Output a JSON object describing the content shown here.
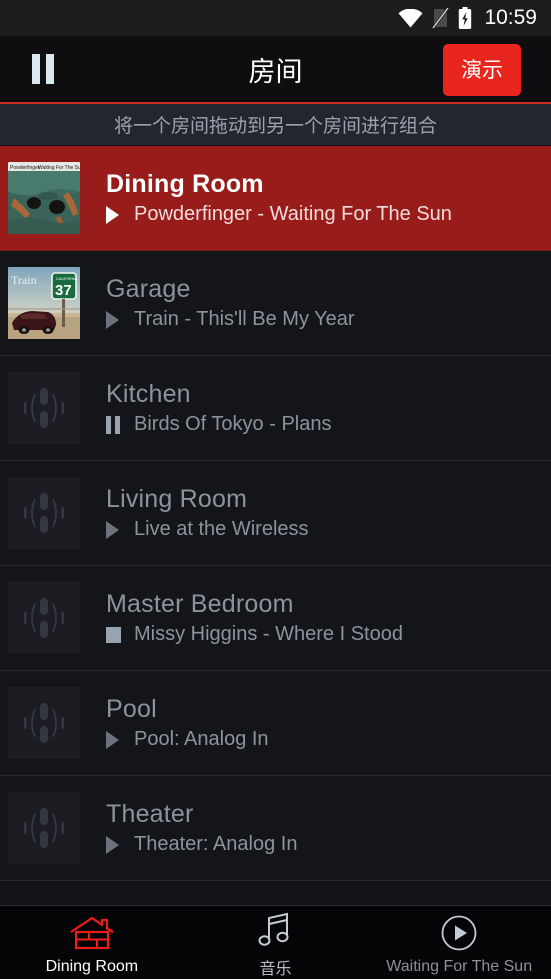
{
  "statusbar": {
    "time": "10:59",
    "icons": [
      "wifi-icon",
      "no-sim-icon",
      "battery-charging-icon"
    ]
  },
  "appbar": {
    "pause_label": "pause-button",
    "title": "房间",
    "demo_label": "演示",
    "accent_color": "#e8261e"
  },
  "hint": {
    "text": "将一个房间拖动到另一个房间进行组合"
  },
  "rooms": [
    {
      "name": "Dining Room",
      "track": "Powderfinger - Waiting For The Sun",
      "state": "play",
      "art": "album-art-waiting-for-the-sun",
      "selected": true
    },
    {
      "name": "Garage",
      "track": "Train - This'll Be My Year",
      "state": "play",
      "art": "album-art-train-california-37",
      "selected": false
    },
    {
      "name": "Kitchen",
      "track": "Birds Of Tokyo - Plans",
      "state": "pause",
      "art": "speaker-placeholder",
      "selected": false
    },
    {
      "name": "Living Room",
      "track": "Live at the Wireless",
      "state": "play",
      "art": "speaker-placeholder",
      "selected": false
    },
    {
      "name": "Master Bedroom",
      "track": "Missy Higgins - Where I Stood",
      "state": "stop",
      "art": "speaker-placeholder",
      "selected": false
    },
    {
      "name": "Pool",
      "track": "Pool: Analog In",
      "state": "play",
      "art": "speaker-placeholder",
      "selected": false
    },
    {
      "name": "Theater",
      "track": "Theater: Analog In",
      "state": "play",
      "art": "speaker-placeholder",
      "selected": false
    }
  ],
  "bottomnav": [
    {
      "label": "Dining Room",
      "icon": "house-icon",
      "active": true
    },
    {
      "label": "音乐",
      "icon": "music-note-icon",
      "active": false
    },
    {
      "label": "Waiting For The Sun",
      "icon": "play-circle-icon",
      "active": false
    }
  ]
}
